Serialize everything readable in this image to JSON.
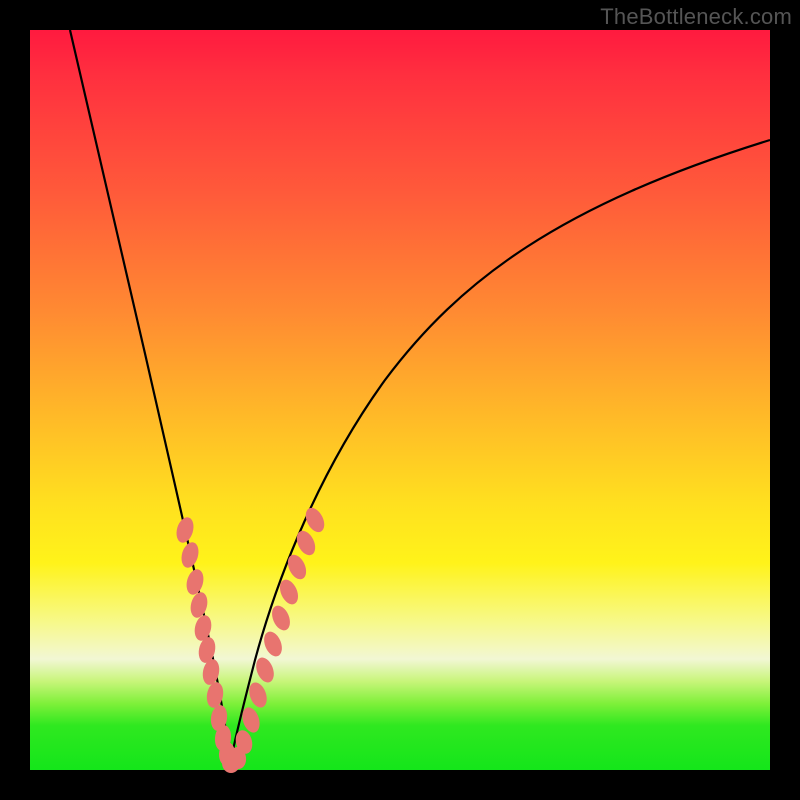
{
  "watermark": "TheBottleneck.com",
  "colors": {
    "frame": "#000000",
    "curve": "#000000",
    "bead": "#e8746f",
    "gradient_stops": [
      "#ff1a3f",
      "#ff5a3a",
      "#ffb928",
      "#fff31a",
      "#f2f7d4",
      "#2fe820",
      "#14e61a"
    ]
  },
  "chart_data": {
    "type": "line",
    "title": "",
    "xlabel": "",
    "ylabel": "",
    "xlim": [
      0,
      100
    ],
    "ylim": [
      0,
      100
    ],
    "y_meaning": "bottleneck_percent (0 = optimal at bottom of dip, 100 = severe)",
    "series": [
      {
        "name": "bottleneck_curve",
        "x": [
          0,
          3,
          6,
          9,
          12,
          15,
          18,
          20,
          22,
          23.5,
          25,
          26,
          27,
          28.5,
          30,
          33,
          37,
          42,
          48,
          55,
          63,
          72,
          82,
          92,
          100
        ],
        "y": [
          100,
          90,
          80,
          69,
          58,
          46,
          33,
          23,
          14,
          7,
          2,
          0,
          2,
          6,
          12,
          22,
          34,
          46,
          56,
          65,
          73,
          79,
          83,
          86,
          88
        ]
      }
    ],
    "optimum_x": 26,
    "beads": {
      "note": "approximate positions of pink capsule markers along the curve near the dip; values are (x, y) in the same 0–100 space as the curve",
      "points": [
        [
          19.8,
          24
        ],
        [
          20.4,
          21
        ],
        [
          21.0,
          18
        ],
        [
          21.4,
          16
        ],
        [
          22.0,
          13.5
        ],
        [
          22.4,
          11.5
        ],
        [
          23.0,
          9
        ],
        [
          23.6,
          6.5
        ],
        [
          24.2,
          4.5
        ],
        [
          24.8,
          3
        ],
        [
          25.4,
          1.6
        ],
        [
          26.0,
          0.8
        ],
        [
          26.6,
          1.4
        ],
        [
          27.2,
          2.8
        ],
        [
          27.8,
          4.6
        ],
        [
          28.6,
          7
        ],
        [
          29.4,
          10
        ],
        [
          30.2,
          13
        ],
        [
          31.0,
          16
        ],
        [
          31.8,
          19.5
        ],
        [
          32.6,
          23
        ],
        [
          33.4,
          26.5
        ],
        [
          34.2,
          30
        ]
      ]
    }
  }
}
